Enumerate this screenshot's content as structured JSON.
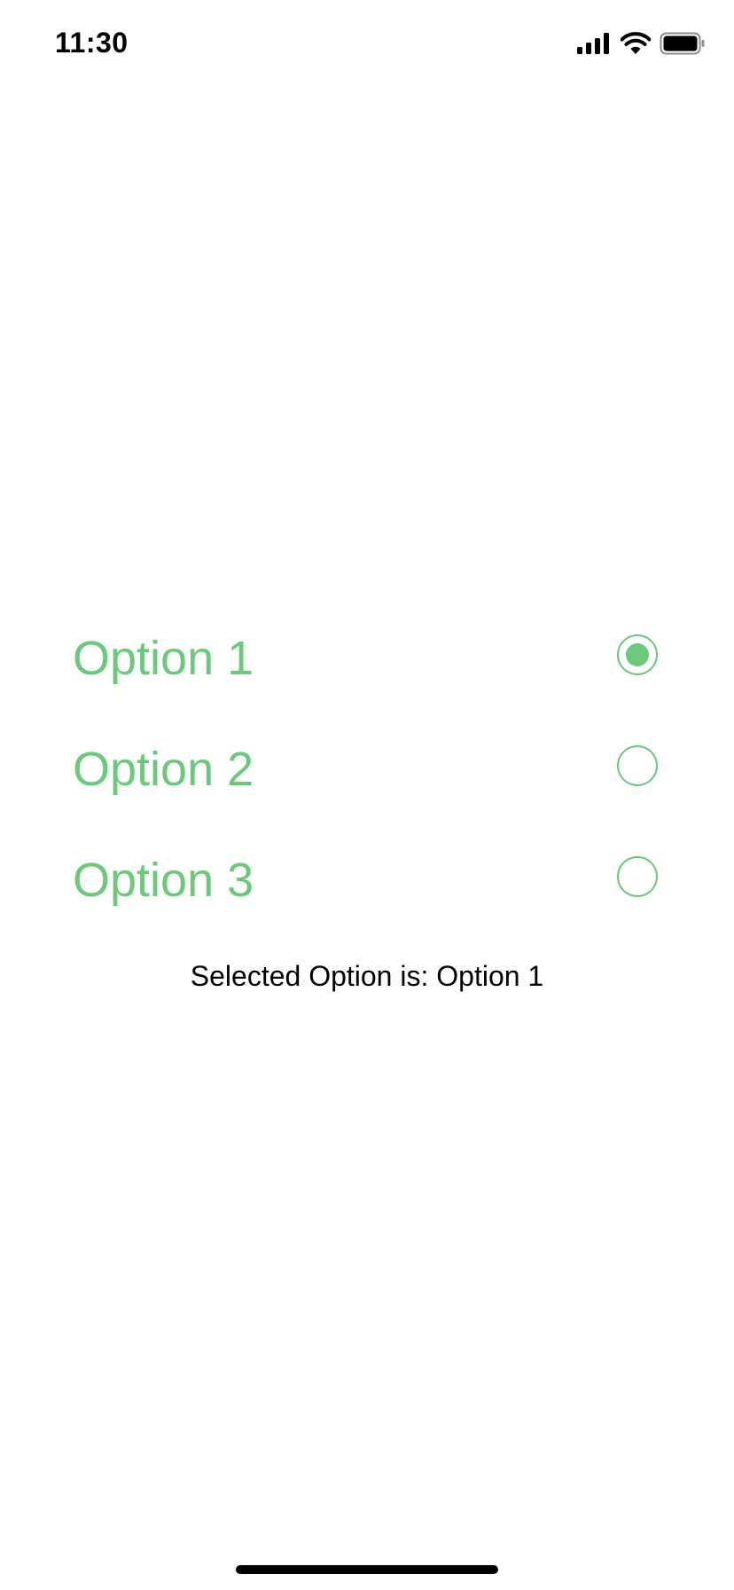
{
  "status_bar": {
    "time": "11:30",
    "icons": [
      "cellular-signal-icon",
      "wifi-icon",
      "battery-icon"
    ]
  },
  "options": [
    {
      "label": "Option 1",
      "selected": true
    },
    {
      "label": "Option 2",
      "selected": false
    },
    {
      "label": "Option 3",
      "selected": false
    }
  ],
  "selected_text": "Selected Option is: Option 1",
  "colors": {
    "accent": "#6cc97c",
    "text": "#000000",
    "background": "#ffffff"
  }
}
